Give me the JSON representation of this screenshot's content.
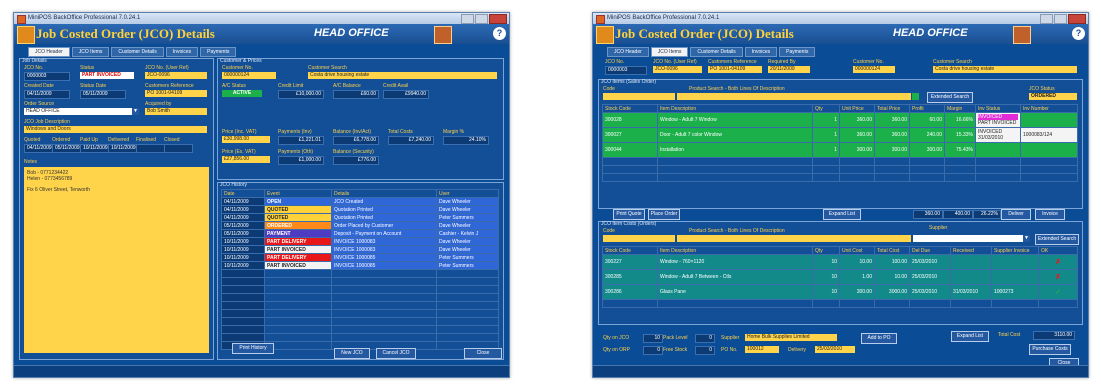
{
  "left": {
    "title": "MiniPOS BackOffice Professional 7.0.24.1",
    "header": "Job Costed Order (JCO) Details",
    "office": "HEAD OFFICE",
    "help": "?",
    "tabs": [
      "JCO Header",
      "JCO Items",
      "Customer Details",
      "Invoices",
      "Payments"
    ],
    "job_panel": "Job Details",
    "jco_no_label": "JCO No.",
    "jco_no": "0000003",
    "status_label": "Status",
    "status": "PART INVOICED",
    "jco_no_user_label": "JCO No. (User Ref)",
    "jco_no_user": "JCO-0096",
    "created_label": "Created Date",
    "created": "04/11/2009",
    "status_date_label": "Status Date",
    "status_date": "05/11/2009",
    "cust_ref_label": "Customers Reference",
    "cust_ref": "PO 1001-04109",
    "order_source_label": "Order Source",
    "order_source": "HEAD OFFICE",
    "acquired_label": "Acquired by",
    "acquired": "Bob Smith",
    "desc_label": "JCO Job Description",
    "desc": "Windows and Doors",
    "dates_labels": [
      "Quoted",
      "Ordered",
      "Paid Up",
      "Delivered",
      "Finalised",
      "Closed"
    ],
    "dates_values": [
      "04/11/2009",
      "05/11/2009",
      "10/11/2009",
      "10/11/2009",
      "",
      ""
    ],
    "notes_label": "Notes",
    "notes": [
      "Bob - 0771234422",
      "Helen - 0773456789",
      "",
      "Fix 6 Oliver Street, Tenworth"
    ],
    "cust_panel": "Customer & Prices",
    "cust_no_label": "Customer No.",
    "cust_no": "000000124",
    "cust_search_label": "Customer Search",
    "cust_search": "Costa drive housing estate",
    "ac_status_label": "A/C Status",
    "ac_status": "ACTIVE",
    "credit_limit_label": "Credit Limit",
    "credit_limit": "£10,000.00",
    "ac_balance_label": "A/C Balance",
    "ac_balance": "£60.00",
    "credit_avail_label": "Credit Avail",
    "credit_avail": "£9940.00",
    "price_label": "Price (Inc. VAT)",
    "price": "£30,998.00",
    "payments_label": "Payments (Inv)",
    "payments": "£1,221.01",
    "balance_label": "Balance (Inv/Act)",
    "balance": "£6,778.00",
    "total_costs_label": "Total Costs",
    "total_costs": "£7,240.00",
    "margin_label": "Margin %",
    "margin": "24.10%",
    "price_ex_label": "Price (Ex. VAT)",
    "price_ex": "£27,856.00",
    "payments_oth_label": "Payments (Oth)",
    "payments_oth": "£1,000.00",
    "balance_sec_label": "Balance (Security)",
    "balance_sec": "£776.00",
    "history_panel": "JCO History",
    "history_cols": [
      "Date",
      "Event",
      "Details",
      "User"
    ],
    "history_rows": [
      {
        "date": "04/11/2009",
        "event": "OPEN",
        "details": "JCO Created",
        "user": "Dave Wheeler",
        "color": "#2f66d8"
      },
      {
        "date": "04/11/2009",
        "event": "QUOTED",
        "details": "Quotation Printed",
        "user": "Dave Wheeler",
        "color": "#ffd23a"
      },
      {
        "date": "04/11/2009",
        "event": "QUOTED",
        "details": "Quotation Printed",
        "user": "Peter Summers",
        "color": "#ffd23a"
      },
      {
        "date": "05/11/2009",
        "event": "ORDERED",
        "details": "Order Placed by Customer",
        "user": "Dave Wheeler",
        "color": "#ff8a1a"
      },
      {
        "date": "05/11/2009",
        "event": "PAYMENT",
        "details": "Deposit - Payment on Account",
        "user": "Cashier - Kelvin J",
        "color": "#4d3cc2"
      },
      {
        "date": "10/11/2009",
        "event": "PART DELIVERY",
        "details": "INVOICE 1000083",
        "user": "Dave Wheeler",
        "color": "#e81818"
      },
      {
        "date": "10/11/2009",
        "event": "PART INVOICED",
        "details": "INVOICE 1000083",
        "user": "Dave Wheeler",
        "color": "#f4f4f4"
      },
      {
        "date": "10/11/2009",
        "event": "PART DELIVERY",
        "details": "INVOICE 1000085",
        "user": "Peter Summers",
        "color": "#e81818"
      },
      {
        "date": "10/11/2009",
        "event": "PART INVOICED",
        "details": "INVOICE 1000085",
        "user": "Peter Summers",
        "color": "#f4f4f4"
      }
    ],
    "print_history": "Print History",
    "new_jco": "New JCO",
    "cancel_jco": "Cancel JCO",
    "close": "Close"
  },
  "right": {
    "title": "MiniPOS BackOffice Professional 7.0.24.1",
    "header": "Job Costed Order (JCO) Details",
    "office": "HEAD OFFICE",
    "help": "?",
    "tabs": [
      "JCO Header",
      "JCO Items",
      "Customer Details",
      "Invoices",
      "Payments"
    ],
    "top_labels": [
      "JCO No.",
      "JCO No. (User Ref)",
      "Customers Reference",
      "Required By",
      "Customer No.",
      "Customer Search"
    ],
    "top_values": [
      "0000003",
      "JCO-0096",
      "PO 1001-04109",
      "20/11/2009",
      "000000124",
      "Costa drive housing estate"
    ],
    "sale_panel": "JCO Items (Sales Order)",
    "code_label": "Code",
    "product_search_label": "Product Search - Both Lines Of Description",
    "extended_search": "Extended Search",
    "jco_status_label": "JCO Status",
    "jco_status": "ORDERED",
    "sale_cols": [
      "Stock Code",
      "Item Description",
      "Qty",
      "Unit Price",
      "Total Price",
      "Profit",
      "Margin",
      "Inv Status",
      "Inv Number"
    ],
    "sale_rows": [
      {
        "code": "300028",
        "desc": "Window - Adult 7 Window",
        "qty": "1",
        "unit": "360.00",
        "total": "360.00",
        "profit": "60.00",
        "margin": "16.66%",
        "inv": "INVOICED",
        "inv2": "PART INVOICED",
        "num": ""
      },
      {
        "code": "300027",
        "desc": "Door - Adult 7 color Window",
        "qty": "1",
        "unit": "360.00",
        "total": "360.00",
        "profit": "240.00",
        "margin": "15.33%",
        "inv": "INVOICED",
        "inv2": "31/03/2010",
        "num": "1000083/124"
      },
      {
        "code": "300044",
        "desc": "Installation",
        "qty": "1",
        "unit": "300.00",
        "total": "300.00",
        "profit": "300.00",
        "margin": "75.43%",
        "inv": "",
        "inv2": "",
        "num": ""
      }
    ],
    "print_quote": "Print Quote",
    "place_order": "Place Order",
    "expand_list": "Expand List",
    "sale_totals": [
      "360.00",
      "400.00",
      "26.22%"
    ],
    "deliver": "Deliver",
    "invoice": "Invoice",
    "cost_panel": "JCO Item Costs (Orders)",
    "supplier_label": "Supplier",
    "cost_cols": [
      "Stock Code",
      "Item Description",
      "Qty",
      "Unit Cost",
      "Total Cost",
      "Del Due",
      "Received",
      "Supplier Invoice",
      "OK"
    ],
    "cost_rows": [
      {
        "code": "300227",
        "desc": "Window - 760×1120",
        "qty": "10",
        "unit": "10.00",
        "total": "100.00",
        "due": "25/03/2010",
        "rec": "",
        "sinv": "",
        "ok": "✗",
        "okc": "#e81818"
      },
      {
        "code": "300285",
        "desc": "Window - Adult 7 Between - Ctls",
        "qty": "10",
        "unit": "1.00",
        "total": "10.00",
        "due": "25/03/2010",
        "rec": "",
        "sinv": "",
        "ok": "✗",
        "okc": "#e81818"
      },
      {
        "code": "300286",
        "desc": "Glass Pane",
        "qty": "10",
        "unit": "300.00",
        "total": "3000.00",
        "due": "25/03/2010",
        "rec": "31/03/2010",
        "sinv": "1000273",
        "ok": "✓",
        "okc": "#1bb04a"
      }
    ],
    "qty_jco_label": "Qty on JCO",
    "qty_jco": "10",
    "pack_label": "Pack Level",
    "pack": "0",
    "qty_ordered_label": "Qty on ORP",
    "qty_ordered": "0",
    "free_stock_label": "Free Stock",
    "free_stock": "0",
    "supplier_text_label": "Supplier",
    "supplier_text": "Home Bulk Supplies Limited",
    "po_label": "PO No.",
    "po": "100012",
    "delivery_label": "Delivery",
    "delivery": "25/03/2010",
    "add_to_po": "Add to PO",
    "expand_list2": "Expand List",
    "total_cost_label": "Total Cost",
    "total_cost": "3110.00",
    "purchase_costs": "Purchase Costs",
    "close": "Close"
  }
}
